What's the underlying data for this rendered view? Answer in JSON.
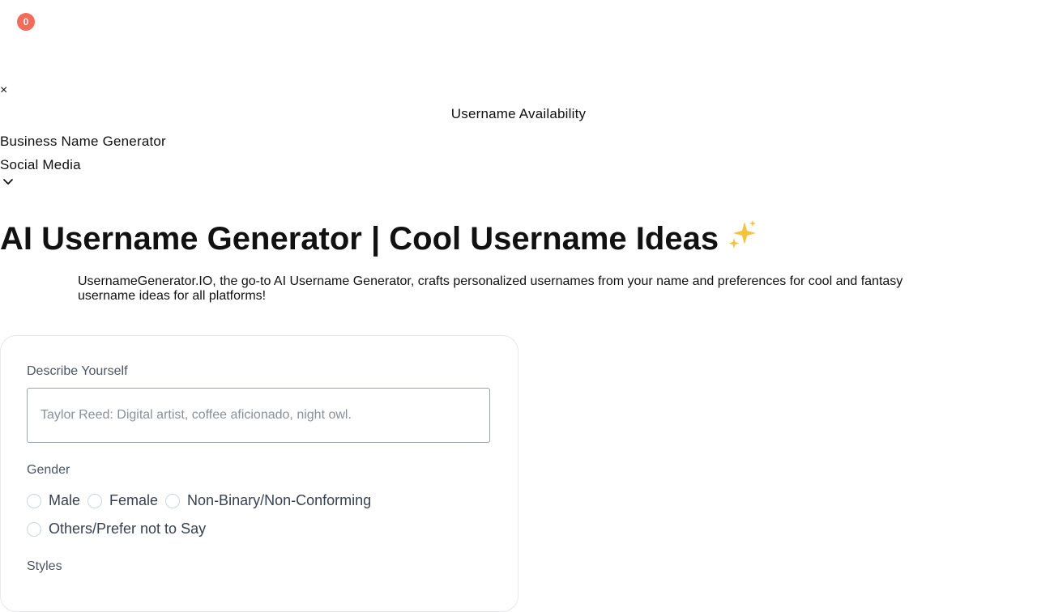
{
  "notification": {
    "count": "0"
  },
  "nav": {
    "close_symbol": "×",
    "username_availability": "Username Availability",
    "business_name_generator": "Business Name Generator",
    "social_media": "Social Media",
    "dropdown_icon": "chevron-down-icon"
  },
  "hero": {
    "title": "AI Username Generator | Cool Username Ideas",
    "title_icon": "sparkles-icon",
    "intro": "UsernameGenerator.IO, the go-to AI Username Generator, crafts personalized usernames from your name and preferences for cool and fantasy username ideas for all platforms!"
  },
  "form": {
    "describe_label": "Describe Yourself",
    "describe_placeholder": "Taylor Reed: Digital artist, coffee aficionado, night owl.",
    "describe_value": "",
    "gender_label": "Gender",
    "gender_options": [
      "Male",
      "Female",
      "Non-Binary/Non-Conforming",
      "Others/Prefer not to Say"
    ],
    "styles_label": "Styles"
  },
  "colors": {
    "badge": "#f26b5b",
    "label_text": "#4b5563",
    "card_border": "#e6e8ec"
  }
}
